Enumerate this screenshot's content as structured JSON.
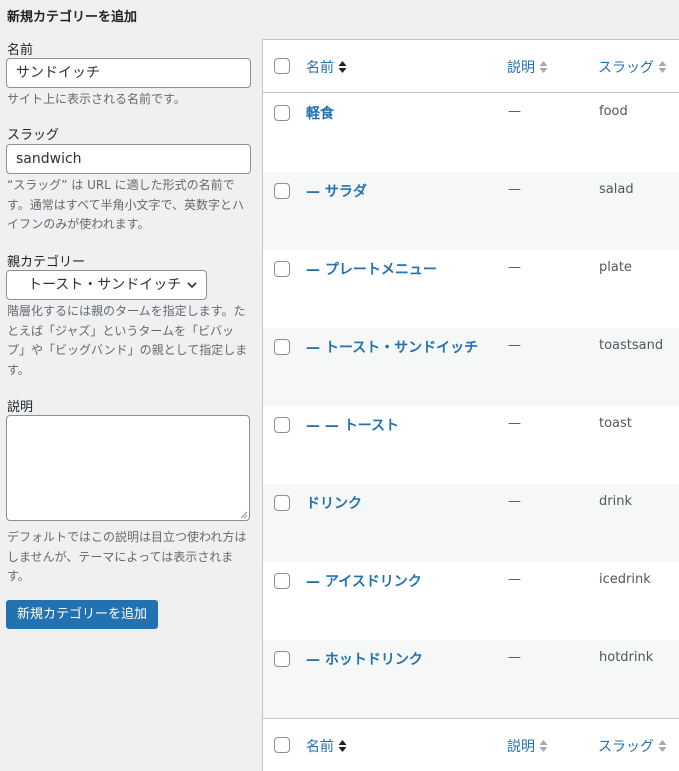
{
  "form": {
    "heading": "新規カテゴリーを追加",
    "name_label": "名前",
    "name_value": "サンドイッチ",
    "name_desc": "サイト上に表示される名前です。",
    "slug_label": "スラッグ",
    "slug_value": "sandwich",
    "slug_desc": "“スラッグ” は URL に適した形式の名前です。通常はすべて半角小文字で、英数字とハイフンのみが使われます。",
    "parent_label": "親カテゴリー",
    "parent_value": "トースト・サンドイッチ",
    "parent_desc": "階層化するには親のタームを指定します。たとえば「ジャズ」というタームを「ビバップ」や「ビッグバンド」の親として指定します。",
    "description_label": "説明",
    "description_value": "",
    "description_desc": "デフォルトではこの説明は目立つ使われ方はしませんが、テーマによっては表示されます。",
    "submit_label": "新規カテゴリーを追加"
  },
  "table": {
    "columns": {
      "name": "名前",
      "description": "説明",
      "slug": "スラッグ"
    },
    "rows": [
      {
        "name": "軽食",
        "description": "—",
        "slug": "food"
      },
      {
        "name": "— サラダ",
        "description": "—",
        "slug": "salad"
      },
      {
        "name": "— プレートメニュー",
        "description": "—",
        "slug": "plate"
      },
      {
        "name": "— トースト・サンドイッチ",
        "description": "—",
        "slug": "toastsand"
      },
      {
        "name": "— — トースト",
        "description": "—",
        "slug": "toast"
      },
      {
        "name": "ドリンク",
        "description": "—",
        "slug": "drink"
      },
      {
        "name": "— アイスドリンク",
        "description": "—",
        "slug": "icedrink"
      },
      {
        "name": "— ホットドリンク",
        "description": "—",
        "slug": "hotdrink"
      }
    ]
  },
  "colors": {
    "accent": "#2271b1",
    "page_bg": "#f0f0f1",
    "row_alt": "#f6f7f7",
    "border": "#c3c4c7"
  },
  "icons": {
    "sort": "sort-arrows-icon",
    "select": "chevron-down-icon",
    "resize": "resize-grip-icon"
  }
}
